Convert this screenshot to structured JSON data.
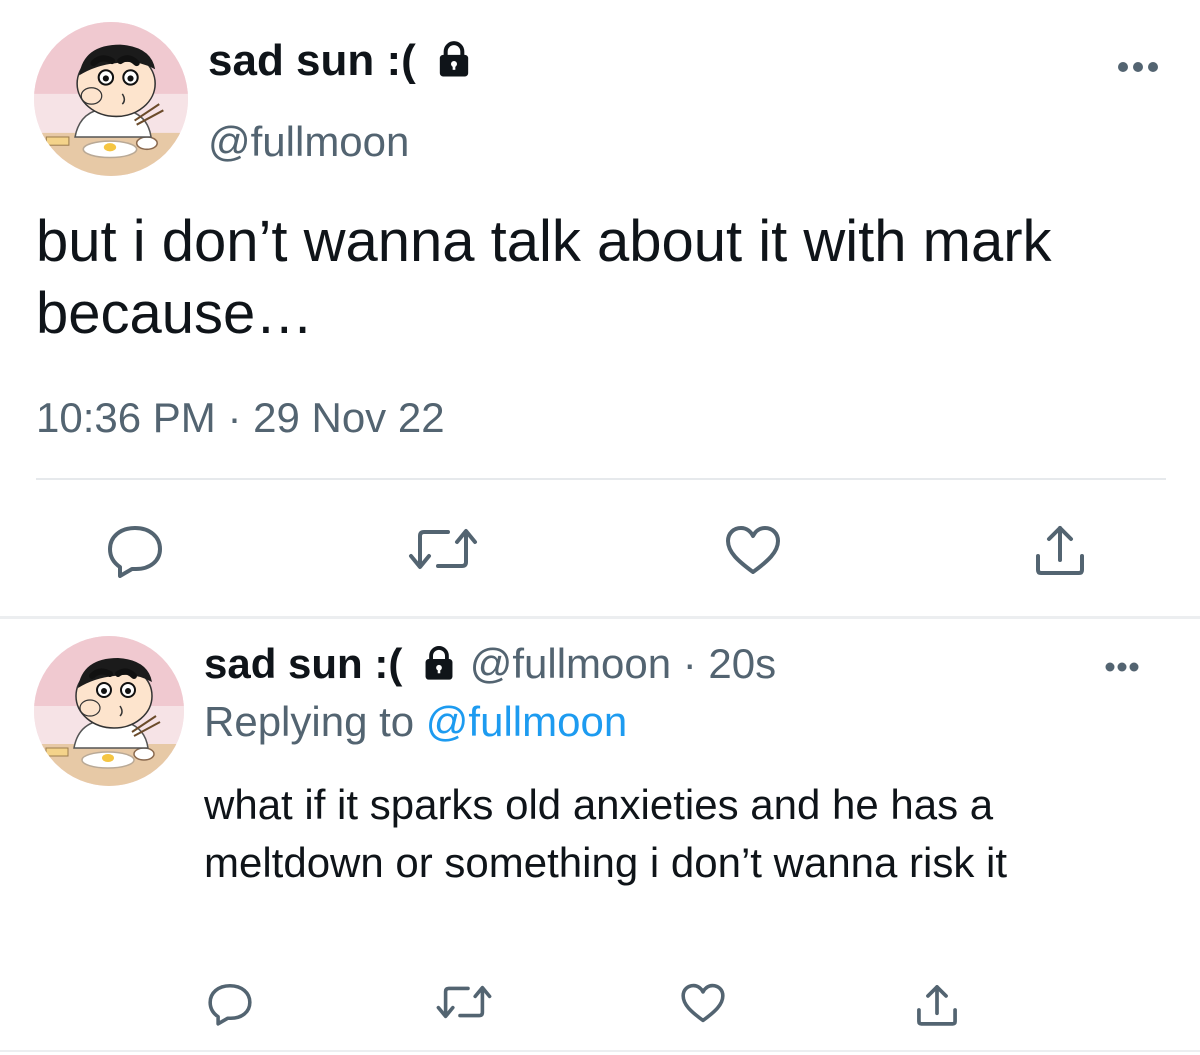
{
  "main_tweet": {
    "display_name": "sad sun :(",
    "handle": "@fullmoon",
    "text": "but i don’t wanna talk about it with mark because…",
    "time": "10:36 PM",
    "separator": " · ",
    "date": "29 Nov 22"
  },
  "reply_tweet": {
    "display_name": "sad sun :(",
    "handle": "@fullmoon",
    "separator": " · ",
    "age": "20s",
    "replying_prefix": "Replying to ",
    "replying_to": "@fullmoon",
    "text": "what if it sparks old anxieties and he has a meltdown or something i don’t wanna risk it"
  },
  "icons": {
    "avatar": "cartoon-avatar",
    "lock": "lock-icon",
    "more": "more-dots-icon",
    "reply": "reply-icon",
    "retweet": "retweet-icon",
    "like": "heart-icon",
    "share": "share-icon"
  },
  "colors": {
    "text": "#0f1419",
    "secondary": "#536471",
    "accent": "#1d9bf0",
    "icon": "#536471",
    "divider": "#e6e9ec"
  }
}
